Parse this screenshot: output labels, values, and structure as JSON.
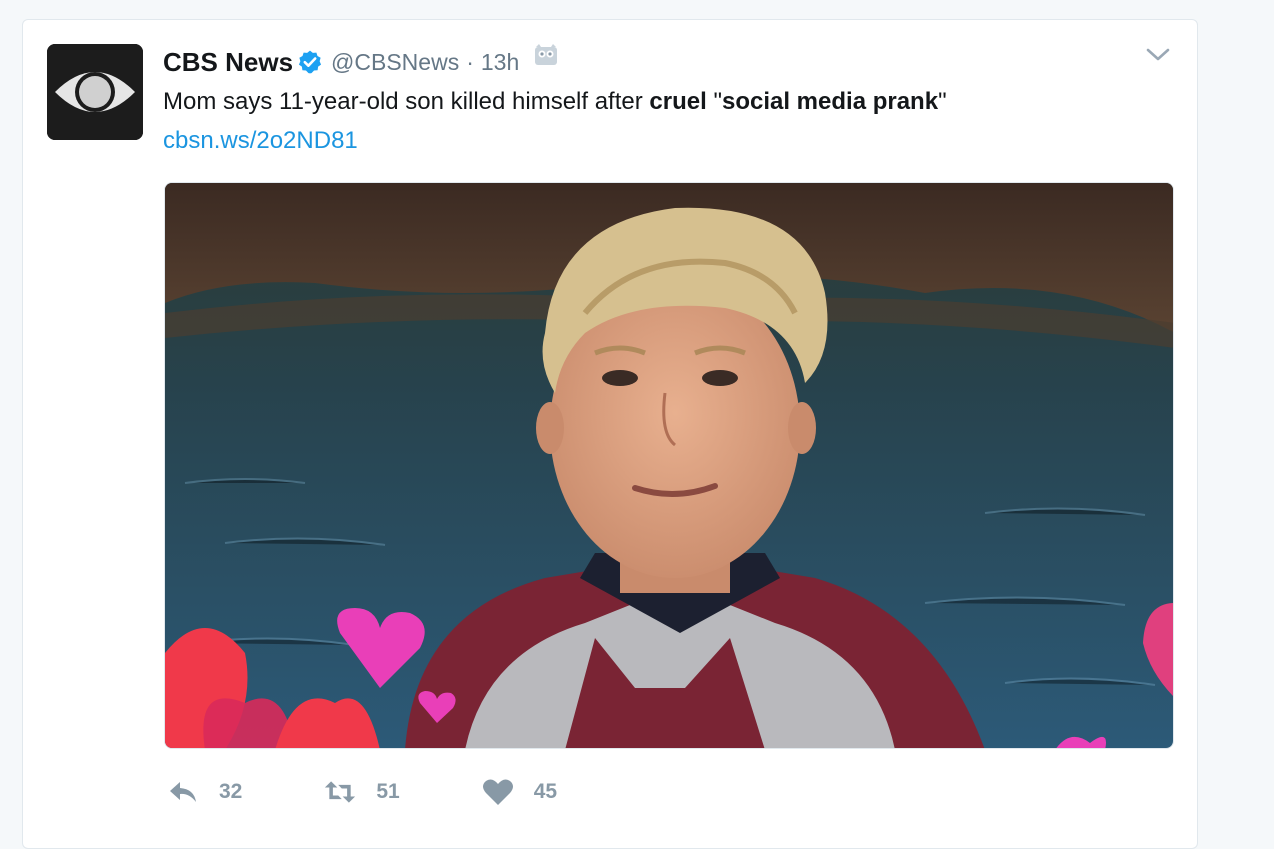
{
  "tweet": {
    "display_name": "CBS News",
    "verified": true,
    "handle": "@CBSNews",
    "separator": "·",
    "time": "13h",
    "text": {
      "part1": "Mom says 11-year-old son killed himself after ",
      "bold1": "cruel",
      "part2": " \"",
      "bold2": "social media prank",
      "part3": "\""
    },
    "link": "cbsn.ws/2o2ND81",
    "media": {
      "icon": "photo"
    },
    "actions": {
      "replies": "32",
      "retweets": "51",
      "likes": "45"
    }
  },
  "colors": {
    "link": "#1b95e0",
    "verified": "#1da1f2",
    "muted": "#657786",
    "action": "#8899a6"
  },
  "icons": {
    "avatar": "cbs-eye-logo",
    "verified": "verified-badge-icon",
    "owl": "owl-icon",
    "menu": "chevron-down-icon",
    "reply": "reply-icon",
    "retweet": "retweet-icon",
    "like": "heart-icon"
  }
}
